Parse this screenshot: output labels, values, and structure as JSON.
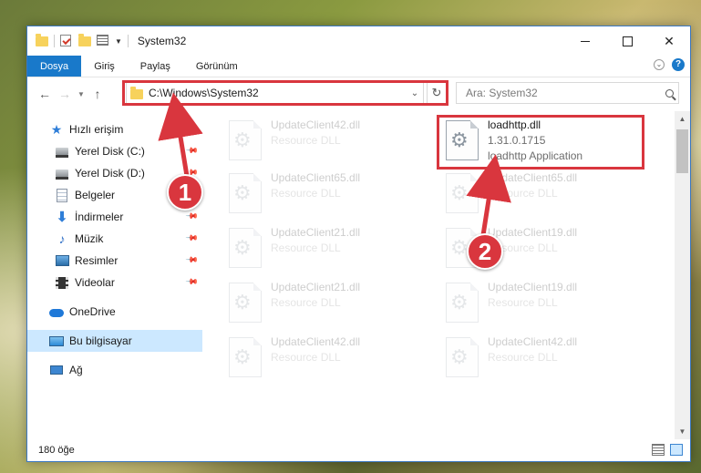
{
  "window": {
    "title": "System32"
  },
  "ribbon": {
    "tabs": [
      "Dosya",
      "Giriş",
      "Paylaş",
      "Görünüm"
    ]
  },
  "address": {
    "path": "C:\\Windows\\System32"
  },
  "search": {
    "placeholder": "Ara: System32"
  },
  "sidebar": {
    "quick_access": "Hızlı erişim",
    "items": [
      {
        "label": "Yerel Disk (C:)",
        "icon": "drive-icon",
        "pinned": true
      },
      {
        "label": "Yerel Disk (D:)",
        "icon": "drive-icon",
        "pinned": true
      },
      {
        "label": "Belgeler",
        "icon": "documents-icon",
        "pinned": true
      },
      {
        "label": "İndirmeler",
        "icon": "download-icon",
        "pinned": true
      },
      {
        "label": "Müzik",
        "icon": "music-icon",
        "pinned": true
      },
      {
        "label": "Resimler",
        "icon": "pictures-icon",
        "pinned": true
      },
      {
        "label": "Videolar",
        "icon": "videos-icon",
        "pinned": true
      }
    ],
    "onedrive": "OneDrive",
    "this_pc": "Bu bilgisayar",
    "network": "Ağ"
  },
  "files": {
    "highlighted": {
      "name": "loadhttp.dll",
      "version": "1.31.0.1715",
      "desc": "loadhttp Application"
    },
    "faded": [
      {
        "name": "UpdateClient42.dll",
        "desc": "Resource DLL"
      },
      {
        "name": "UpdateClient65.dll",
        "desc": "Resource DLL"
      },
      {
        "name": "UpdateClient65.dll",
        "desc": "Resource DLL"
      },
      {
        "name": "UpdateClient21.dll",
        "desc": "Resource DLL"
      },
      {
        "name": "UpdateClient19.dll",
        "desc": "Resource DLL"
      },
      {
        "name": "UpdateClient21.dll",
        "desc": "Resource DLL"
      },
      {
        "name": "UpdateClient19.dll",
        "desc": "Resource DLL"
      },
      {
        "name": "UpdateClient42.dll",
        "desc": "Resource DLL"
      },
      {
        "name": "UpdateClient42.dll",
        "desc": "Resource DLL"
      }
    ]
  },
  "status": {
    "count": "180 öğe"
  },
  "callouts": [
    "1",
    "2"
  ],
  "colors": {
    "accent": "#1979ca",
    "highlight_red": "#d9363e",
    "selection": "#cce8ff"
  }
}
